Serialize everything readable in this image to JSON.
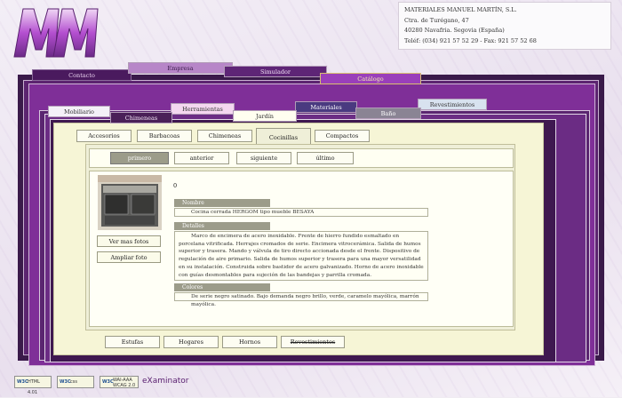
{
  "company": {
    "name": "MATERIALES MANUEL MARTÍN, S.L.",
    "street": "Ctra. de Turégano, 47",
    "city": "40280 Navafria. Segovia (España)",
    "phone": "Teléf: (034) 921 57 52 29 - Fax: 921 57 52 68"
  },
  "main_tabs": [
    "Contacto",
    "Empresa",
    "Simulador",
    "Catálogo"
  ],
  "catalog_tabs": [
    "Mobiliario",
    "Herramientas",
    "Materiales",
    "Revestimientos",
    "Chimeneas",
    "Jardín",
    "Baño"
  ],
  "sub_tabs": [
    "Accesorios",
    "Barbacoas",
    "Chimeneas",
    "Cocinillas",
    "Compactos"
  ],
  "pager": [
    "primero",
    "anterior",
    "siguiente",
    "último"
  ],
  "product": {
    "index": "0",
    "name_label": "Nombre",
    "name": "Cocina cerrada HERGOM tipo mueble BESAYA",
    "details_label": "Detalles",
    "details": "Marco de encimera de acero inoxidable. Frente de hierro fundido esmaltado en porcelana vitrificada. Herrajes cromados de serie. Encimera vitrocerámica. Salida de humos superior y trasera. Mando y válvula de tiro directo accionada desde el frente. Dispositivo de regulación de aire primario. Salida de humos superior y trasera para una mayor versatilidad en su instalación. Construida sobre bastidor de acero galvanizado. Horno de acero inoxidable con guías desmontables para sujeción de las bandejas y parrilla cromada.",
    "colors_label": "Colores",
    "colors": "De serie negro satinado. Bajo demanda negro brillo, verde, caramelo mayólica, marrón mayólica."
  },
  "side_buttons": [
    "Ver mas fotos",
    "Ampliar foto"
  ],
  "bottom_tabs": [
    "Estufas",
    "Hogares",
    "Hornos",
    "Revestimientos"
  ],
  "footer": {
    "w3c_html": "HTML 4.01",
    "w3c_css": "css",
    "w3c_wai": "WAI-AAA WCAG 2.0",
    "examinator": "eXaminator"
  },
  "colors": {
    "purple_dark": "#4a1d5e",
    "purple_main": "#7a2a95",
    "purple_light": "#a24cbf",
    "panel_bg": "#f6f5d6",
    "gray_olive": "#9c9c8a"
  }
}
